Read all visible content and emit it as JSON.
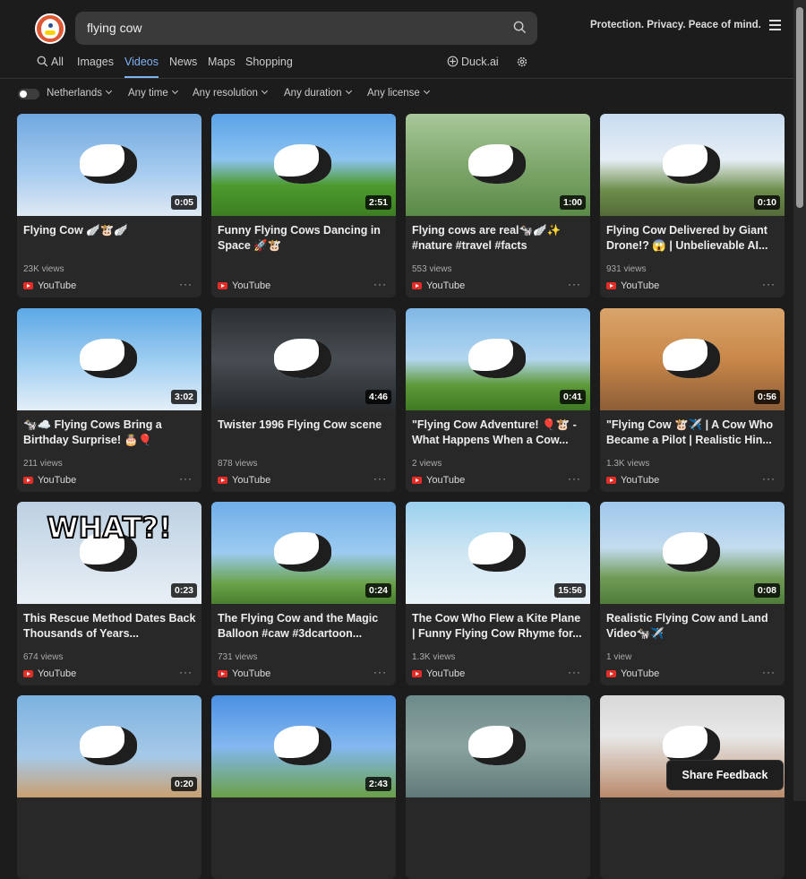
{
  "search": {
    "query": "flying cow"
  },
  "header": {
    "tagline": "Protection. Privacy. Peace of mind."
  },
  "tabs": [
    {
      "label": "All",
      "icon": "search-icon"
    },
    {
      "label": "Images"
    },
    {
      "label": "Videos",
      "active": true
    },
    {
      "label": "News"
    },
    {
      "label": "Maps"
    },
    {
      "label": "Shopping"
    },
    {
      "label": "Duck.ai",
      "icon": "duck-ai-icon"
    },
    {
      "icon": "settings-gear-icon"
    }
  ],
  "filters": {
    "region": "Netherlands",
    "time": "Any time",
    "resolution": "Any resolution",
    "duration": "Any duration",
    "license": "Any license"
  },
  "colors": {
    "accent": "#7eb2f5",
    "background": "#1c1c1c",
    "card": "#282828",
    "youtube": "#e52d27"
  },
  "videos": [
    {
      "duration": "0:05",
      "title": "Flying Cow 🪽🐮🪽",
      "views": "23K views",
      "source": "YouTube"
    },
    {
      "duration": "2:51",
      "title": "Funny Flying Cows Dancing in Space 🚀🐮",
      "views": "",
      "source": "YouTube"
    },
    {
      "duration": "1:00",
      "title": "Flying cows are real🐄🪽✨ #nature #travel #facts",
      "views": "553 views",
      "source": "YouTube"
    },
    {
      "duration": "0:10",
      "title": "Flying Cow Delivered by Giant Drone!? 😱 | Unbelievable AI...",
      "views": "931 views",
      "source": "YouTube"
    },
    {
      "duration": "3:02",
      "title": "🐄☁️ Flying Cows Bring a Birthday Surprise! 🎂🎈",
      "views": "211 views",
      "source": "YouTube"
    },
    {
      "duration": "4:46",
      "title": "Twister 1996 Flying Cow scene",
      "views": "878 views",
      "source": "YouTube"
    },
    {
      "duration": "0:41",
      "title": "\"Flying Cow Adventure! 🎈🐮 - What Happens When a Cow...",
      "views": "2 views",
      "source": "YouTube"
    },
    {
      "duration": "0:56",
      "title": "\"Flying Cow 🐮✈️ | A Cow Who Became a Pilot | Realistic Hin...",
      "views": "1.3K views",
      "source": "YouTube"
    },
    {
      "duration": "0:23",
      "title": "This Rescue Method Dates Back Thousands of Years...",
      "views": "674 views",
      "source": "YouTube",
      "overlay": "WHAT?!"
    },
    {
      "duration": "0:24",
      "title": "The Flying Cow and the Magic Balloon #caw #3dcartoon...",
      "views": "731 views",
      "source": "YouTube"
    },
    {
      "duration": "15:56",
      "title": "The Cow Who Flew a Kite Plane | Funny Flying Cow Rhyme for...",
      "views": "1.3K views",
      "source": "YouTube"
    },
    {
      "duration": "0:08",
      "title": "Realistic Flying Cow and Land Video🐄✈️",
      "views": "1 view",
      "source": "YouTube"
    },
    {
      "duration": "0:20"
    },
    {
      "duration": "2:43"
    },
    {
      "duration": ""
    },
    {
      "duration": ""
    }
  ],
  "feedback_label": "Share Feedback"
}
